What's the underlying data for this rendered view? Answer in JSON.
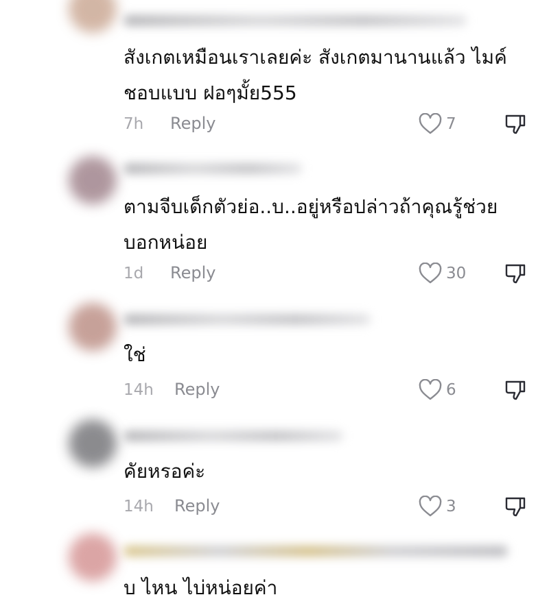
{
  "comments": [
    {
      "text": "สังเกตเหมือนเราเลยค่ะ สังเกตมานานแล้ว ไมค์\nชอบแบบ ฝอๆมั้ย555",
      "time": "7h",
      "reply": "Reply",
      "likes": "7",
      "avatar_color": "#c8a48f"
    },
    {
      "text": "ตามจีบเด็กตัวย่อ..บ..อยู่หรือปล่าวถ้าคุณรู้ช่วย\nบอกหน่อย",
      "time": "1d",
      "reply": "Reply",
      "likes": "30",
      "avatar_color": "#9b7d86"
    },
    {
      "text": "ใช่",
      "time": "14h",
      "reply": "Reply",
      "likes": "6",
      "avatar_color": "#b98a80"
    },
    {
      "text": "คัยหรอค่ะ",
      "time": "14h",
      "reply": "Reply",
      "likes": "3",
      "avatar_color": "#6f6f73"
    },
    {
      "text": "บ ไหน ไบ่หน่อยค่า",
      "avatar_color": "#d38f8f"
    }
  ]
}
